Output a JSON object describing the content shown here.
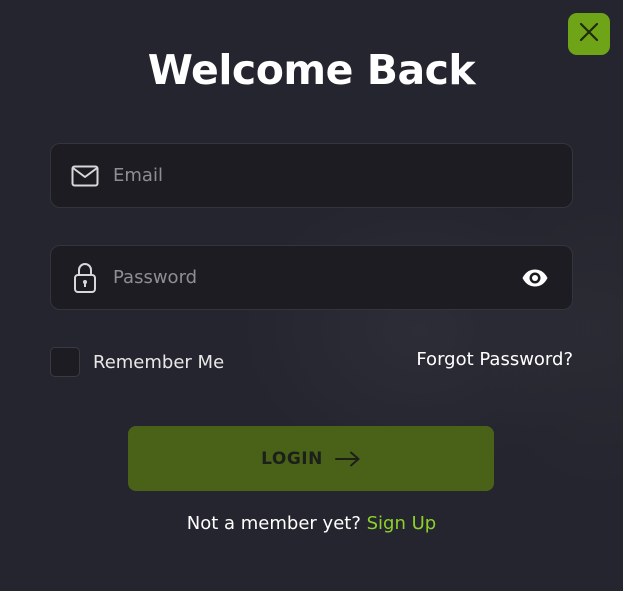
{
  "modal": {
    "title": "Welcome Back",
    "close_icon": "close-icon",
    "accent_color": "#6fa418",
    "link_color": "#8dd22a"
  },
  "email": {
    "icon": "envelope-icon",
    "placeholder": "Email",
    "value": ""
  },
  "password": {
    "icon": "lock-icon",
    "placeholder": "Password",
    "value": "",
    "toggle_icon": "eye-icon"
  },
  "remember": {
    "label": "Remember Me",
    "checked": false
  },
  "forgot": {
    "label": "Forgot Password?"
  },
  "login": {
    "label": "LOGIN",
    "icon": "arrow-right-icon"
  },
  "signup": {
    "prompt": "Not a member yet?",
    "link": "Sign Up"
  }
}
